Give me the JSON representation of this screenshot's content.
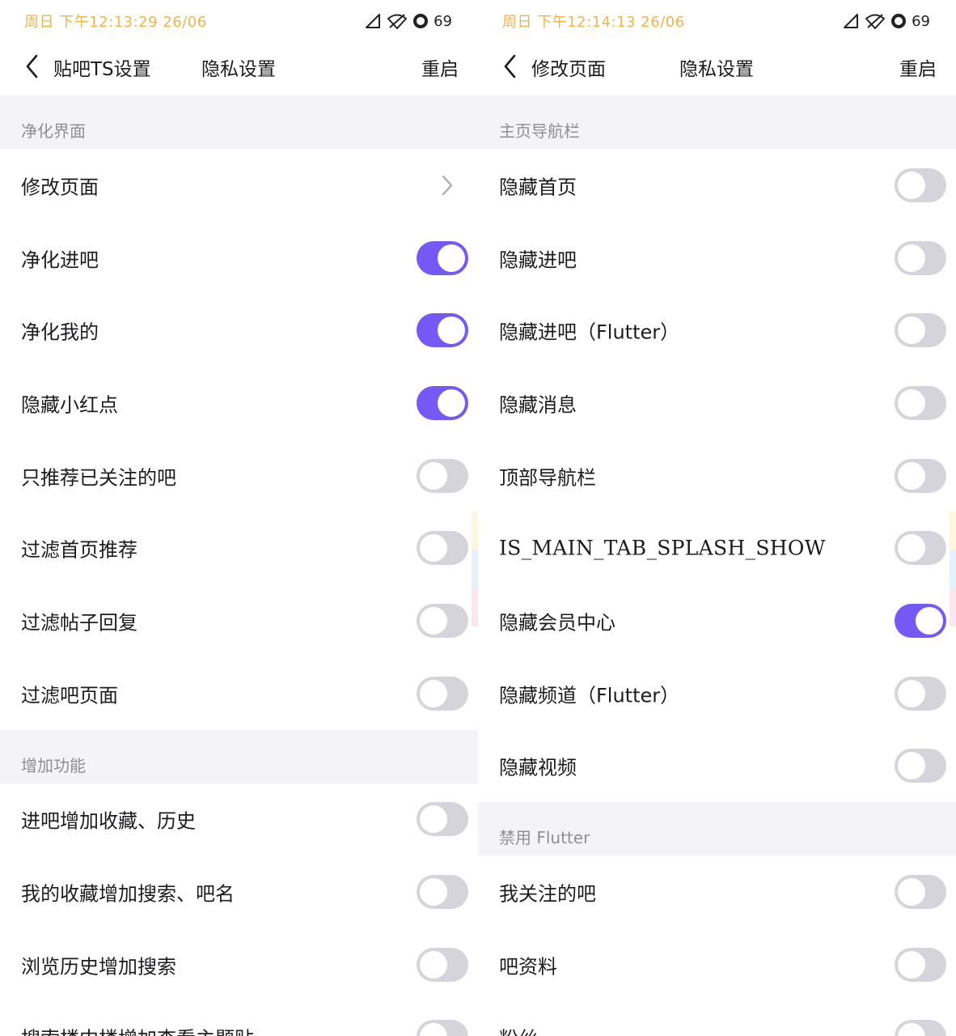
{
  "left": {
    "status": {
      "time": "周日 下午12:13:29 26/06",
      "battery": "69"
    },
    "nav": {
      "title": "贴吧TS设置",
      "privacy": "隐私设置",
      "restart": "重启"
    },
    "sections": [
      {
        "header": "净化界面",
        "rows": [
          {
            "label": "修改页面",
            "type": "link"
          },
          {
            "label": "净化进吧",
            "type": "toggle",
            "on": true
          },
          {
            "label": "净化我的",
            "type": "toggle",
            "on": true
          },
          {
            "label": "隐藏小红点",
            "type": "toggle",
            "on": true
          },
          {
            "label": "只推荐已关注的吧",
            "type": "toggle",
            "on": false
          },
          {
            "label": "过滤首页推荐",
            "type": "toggle",
            "on": false
          },
          {
            "label": "过滤帖子回复",
            "type": "toggle",
            "on": false
          },
          {
            "label": "过滤吧页面",
            "type": "toggle",
            "on": false
          }
        ]
      },
      {
        "header": "增加功能",
        "rows": [
          {
            "label": "进吧增加收藏、历史",
            "type": "toggle",
            "on": false
          },
          {
            "label": "我的收藏增加搜索、吧名",
            "type": "toggle",
            "on": false
          },
          {
            "label": "浏览历史增加搜索",
            "type": "toggle",
            "on": false
          },
          {
            "label": "搜索楼中楼增加查看主题贴",
            "type": "toggle",
            "on": false
          }
        ]
      }
    ]
  },
  "right": {
    "status": {
      "time": "周日 下午12:14:13 26/06",
      "battery": "69"
    },
    "nav": {
      "title": "修改页面",
      "privacy": "隐私设置",
      "restart": "重启"
    },
    "sections": [
      {
        "header": "主页导航栏",
        "rows": [
          {
            "label": "隐藏首页",
            "type": "toggle",
            "on": false
          },
          {
            "label": "隐藏进吧",
            "type": "toggle",
            "on": false
          },
          {
            "label": "隐藏进吧（Flutter）",
            "type": "toggle",
            "on": false
          },
          {
            "label": "隐藏消息",
            "type": "toggle",
            "on": false
          },
          {
            "label": "顶部导航栏",
            "type": "toggle",
            "on": false
          },
          {
            "label": "IS_MAIN_TAB_SPLASH_SHOW",
            "type": "toggle",
            "on": false,
            "mono": true
          },
          {
            "label": "隐藏会员中心",
            "type": "toggle",
            "on": true
          },
          {
            "label": "隐藏频道（Flutter）",
            "type": "toggle",
            "on": false
          },
          {
            "label": "隐藏视频",
            "type": "toggle",
            "on": false
          }
        ]
      },
      {
        "header": "禁用 Flutter",
        "rows": [
          {
            "label": "我关注的吧",
            "type": "toggle",
            "on": false
          },
          {
            "label": "吧资料",
            "type": "toggle",
            "on": false
          },
          {
            "label": "粉丝",
            "type": "toggle",
            "on": false
          }
        ]
      }
    ]
  },
  "colors": {
    "accent": "#7559f5",
    "toggle_off": "#d4d4da",
    "status_time": "#f0b44a",
    "section_bg": "#f4f4f6"
  }
}
